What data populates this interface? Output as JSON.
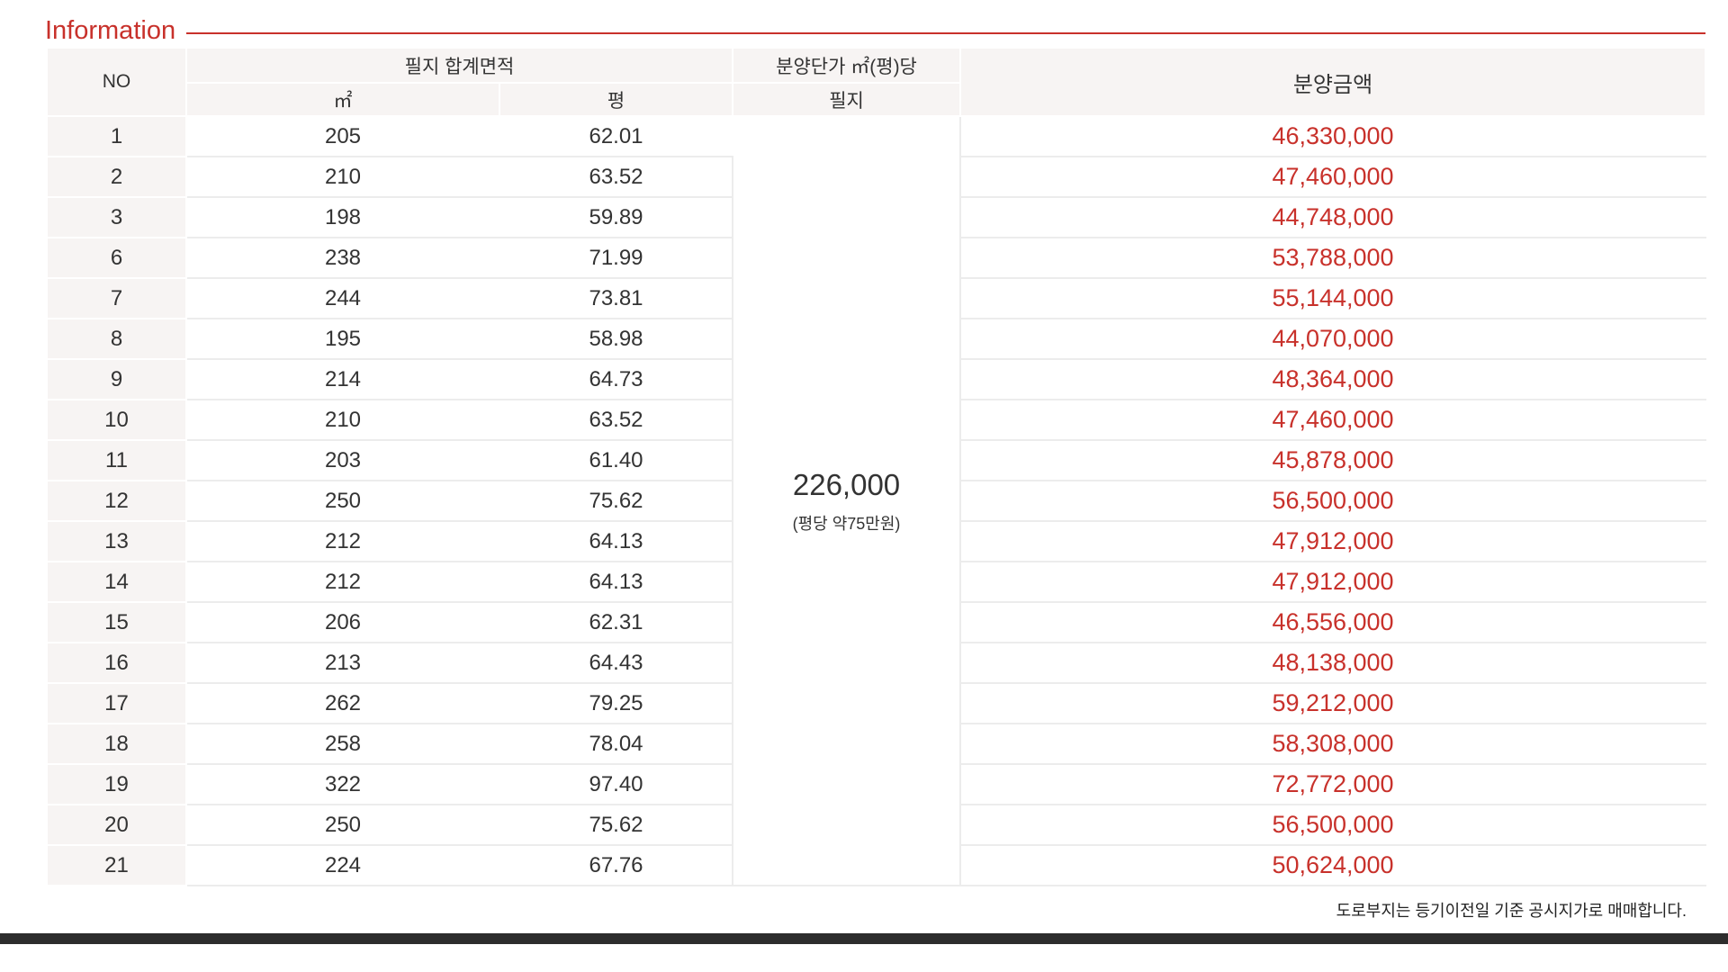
{
  "section": {
    "title": "Information"
  },
  "table": {
    "headers": {
      "no": "NO",
      "area_group": "필지 합계면적",
      "area_m2": "㎡",
      "area_pyeong": "평",
      "unit_price_group": "분양단가 ㎡(평)당",
      "unit_price_sub": "필지",
      "amount": "분양금액"
    },
    "unit_price": {
      "value": "226,000",
      "note": "(평당 약75만원)"
    },
    "rows": [
      {
        "no": "1",
        "m2": "205",
        "pyeong": "62.01",
        "amount": "46,330,000"
      },
      {
        "no": "2",
        "m2": "210",
        "pyeong": "63.52",
        "amount": "47,460,000"
      },
      {
        "no": "3",
        "m2": "198",
        "pyeong": "59.89",
        "amount": "44,748,000"
      },
      {
        "no": "6",
        "m2": "238",
        "pyeong": "71.99",
        "amount": "53,788,000"
      },
      {
        "no": "7",
        "m2": "244",
        "pyeong": "73.81",
        "amount": "55,144,000"
      },
      {
        "no": "8",
        "m2": "195",
        "pyeong": "58.98",
        "amount": "44,070,000"
      },
      {
        "no": "9",
        "m2": "214",
        "pyeong": "64.73",
        "amount": "48,364,000"
      },
      {
        "no": "10",
        "m2": "210",
        "pyeong": "63.52",
        "amount": "47,460,000"
      },
      {
        "no": "11",
        "m2": "203",
        "pyeong": "61.40",
        "amount": "45,878,000"
      },
      {
        "no": "12",
        "m2": "250",
        "pyeong": "75.62",
        "amount": "56,500,000"
      },
      {
        "no": "13",
        "m2": "212",
        "pyeong": "64.13",
        "amount": "47,912,000"
      },
      {
        "no": "14",
        "m2": "212",
        "pyeong": "64.13",
        "amount": "47,912,000"
      },
      {
        "no": "15",
        "m2": "206",
        "pyeong": "62.31",
        "amount": "46,556,000"
      },
      {
        "no": "16",
        "m2": "213",
        "pyeong": "64.43",
        "amount": "48,138,000"
      },
      {
        "no": "17",
        "m2": "262",
        "pyeong": "79.25",
        "amount": "59,212,000"
      },
      {
        "no": "18",
        "m2": "258",
        "pyeong": "78.04",
        "amount": "58,308,000"
      },
      {
        "no": "19",
        "m2": "322",
        "pyeong": "97.40",
        "amount": "72,772,000"
      },
      {
        "no": "20",
        "m2": "250",
        "pyeong": "75.62",
        "amount": "56,500,000"
      },
      {
        "no": "21",
        "m2": "224",
        "pyeong": "67.76",
        "amount": "50,624,000"
      }
    ]
  },
  "footnote": "도로부지는 등기이전일 기준 공시지가로 매매합니다.",
  "colors": {
    "accent": "#c8312b",
    "header_bg": "#f7f4f3",
    "bar": "#2d2d2d"
  }
}
